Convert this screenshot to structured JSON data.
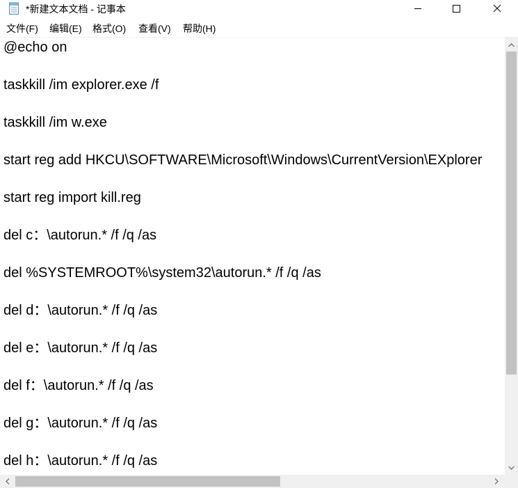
{
  "window": {
    "title": "*新建文本文档 - 记事本",
    "icon": "notepad-icon"
  },
  "caption_buttons": {
    "minimize": "minimize-icon",
    "maximize": "maximize-icon",
    "close": "close-icon"
  },
  "menu": {
    "file": "文件(F)",
    "edit": "编辑(E)",
    "format": "格式(O)",
    "view": "查看(V)",
    "help": "帮助(H)"
  },
  "editor": {
    "lines": [
      "@echo on",
      "taskkill /im explorer.exe /f",
      "taskkill /im w.exe",
      "start reg add HKCU\\SOFTWARE\\Microsoft\\Windows\\CurrentVersion\\EXplorer",
      "start reg import kill.reg",
      "del c：\\autorun.* /f /q /as",
      "del %SYSTEMROOT%\\system32\\autorun.* /f /q /as",
      "del d：\\autorun.* /f /q /as",
      "del e：\\autorun.* /f /q /as",
      "del f：\\autorun.* /f /q /as",
      "del g：\\autorun.* /f /q /as",
      "del h：\\autorun.* /f /q /as"
    ]
  },
  "colors": {
    "scrollbar_track": "#f0f0f0",
    "scrollbar_thumb": "#c2c2c2"
  }
}
